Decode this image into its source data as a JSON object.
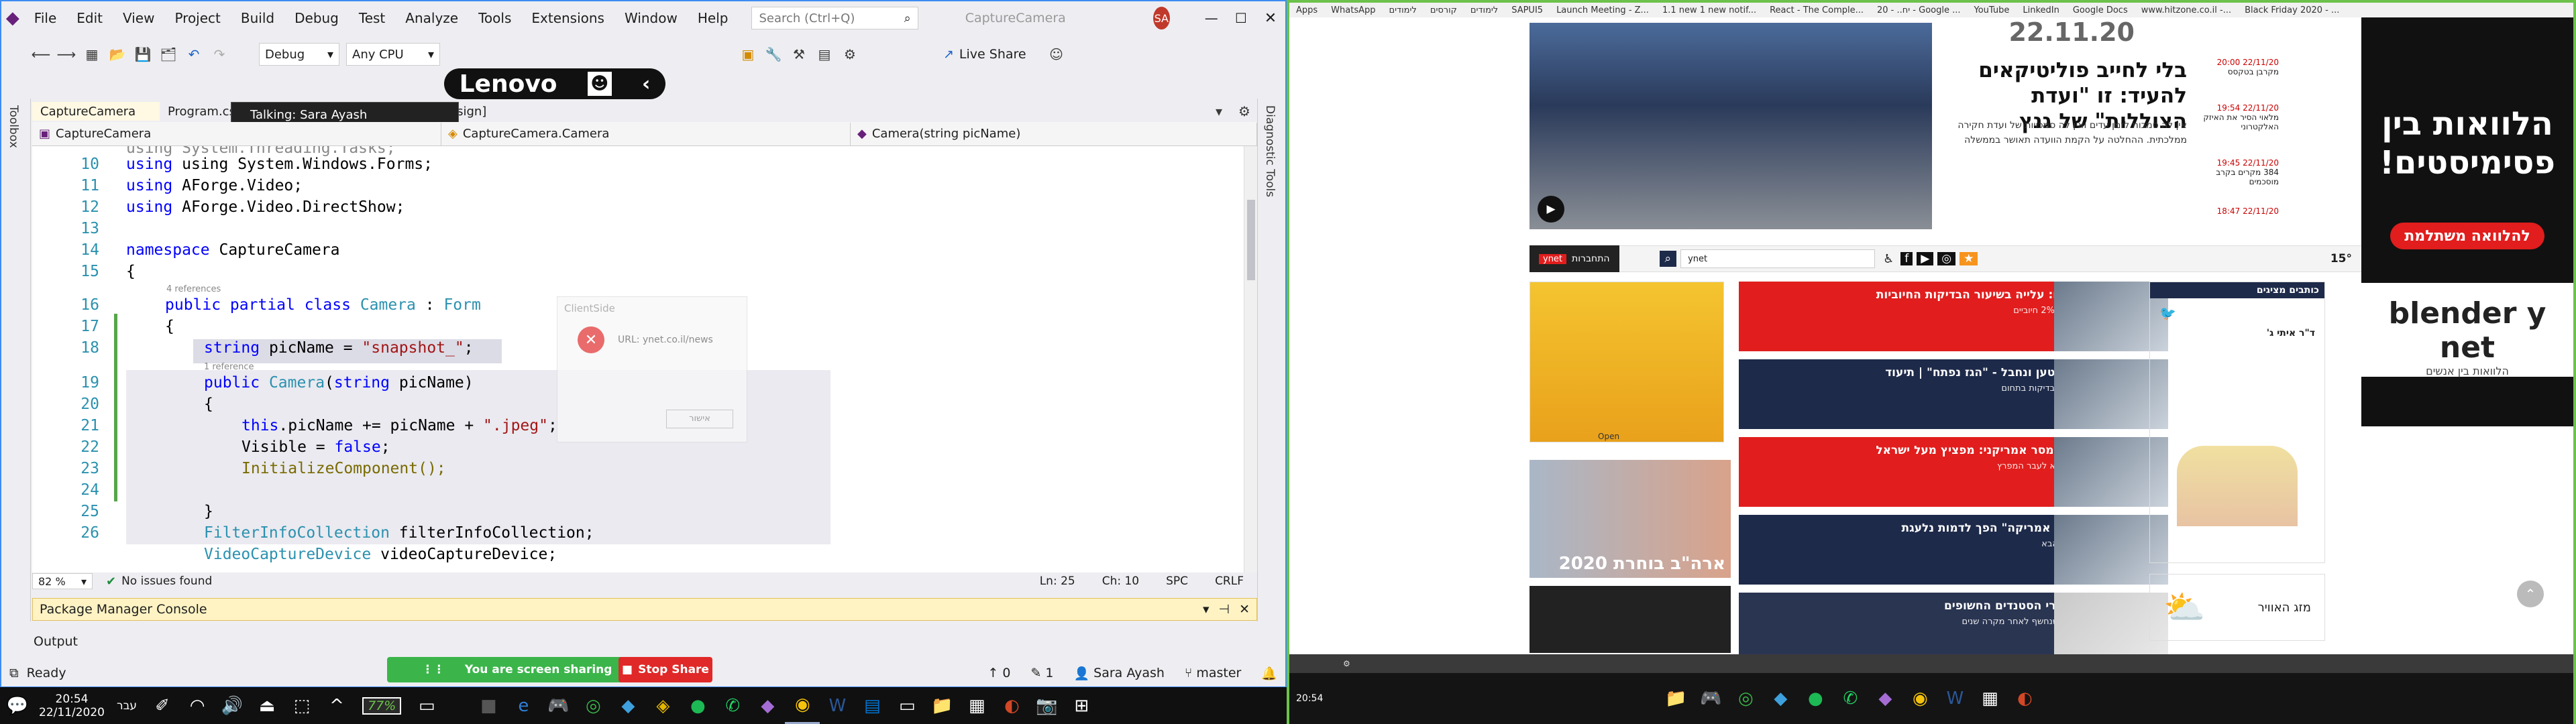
{
  "vs": {
    "menu": [
      "File",
      "Edit",
      "View",
      "Project",
      "Build",
      "Debug",
      "Test",
      "Analyze",
      "Tools",
      "Extensions",
      "Window",
      "Help"
    ],
    "search_placeholder": "Search (Ctrl+Q)",
    "solution_name": "CaptureCamera",
    "user_initials": "SA",
    "live_share": "Live Share",
    "config": "Debug",
    "platform": "Any CPU",
    "lenovo": "Lenovo",
    "talking": "Talking: Sara Ayash",
    "left_strip": "Toolbox",
    "right_strip": "Diagnostic Tools",
    "tabs": [
      "CaptureCamera",
      "Program.cs",
      "esign]"
    ],
    "nav": {
      "project": "CaptureCamera",
      "class": "CaptureCamera.Camera",
      "member": "Camera(string picName)"
    },
    "code": {
      "line10": "using System.Windows.Forms;",
      "line09": "using System.Threading.Tasks;",
      "line11_kw": "using",
      "line11_rest": " AForge.Video;",
      "line12_kw": "using",
      "line12_rest": " AForge.Video.DirectShow;",
      "line14_kw": "namespace",
      "line14_rest": " CaptureCamera",
      "line15": "{",
      "refs": "4 references",
      "line16_a": "public partial class",
      "line16_b": "Camera",
      "line16_c": " : ",
      "line16_d": "Form",
      "line17": "{",
      "line18_a": "string",
      "line18_b": " picName = ",
      "line18_c": "\"snapshot_\"",
      "line18_d": ";",
      "refs2": "1 reference",
      "line19_a": "public",
      "line19_b": "Camera",
      "line19_c": "(",
      "line19_d": "string",
      "line19_e": " picName)",
      "line20": "{",
      "line21_a": "this",
      "line21_b": ".picName += picName + ",
      "line21_c": "\".jpeg\"",
      "line21_d": ";",
      "line22_a": "Visible = ",
      "line22_b": "false",
      "line22_c": ";",
      "line23": "InitializeComponent();",
      "line25": "}",
      "line26_a": "FilterInfoCollection",
      "line26_b": " filterInfoCollection;",
      "line27_a": "VideoCaptureDevice",
      "line27_b": " videoCaptureDevice;"
    },
    "line_numbers": [
      "10",
      "11",
      "12",
      "13",
      "14",
      "15",
      "16",
      "17",
      "18",
      "19",
      "20",
      "21",
      "22",
      "23",
      "24",
      "25",
      "26"
    ],
    "zoom": "82 %",
    "issues": "No issues found",
    "pos": {
      "ln": "Ln: 25",
      "ch": "Ch: 10",
      "spc": "SPC",
      "crlf": "CRLF"
    },
    "client_side": {
      "title": "ClientSide",
      "url": "URL: ynet.co.il/news",
      "btn": "אישור"
    },
    "pmc": "Package Manager Console",
    "output": "Output",
    "status": {
      "ready": "Ready",
      "up": "0",
      "pencil": "1",
      "user": "Sara Ayash",
      "branch": "master",
      "bell": "1"
    },
    "sharing": "You are screen sharing",
    "stop_share": "Stop Share",
    "clock": {
      "time": "20:54",
      "date": "22/11/2020"
    },
    "lang": "עבר",
    "battery": "77%"
  },
  "browser": {
    "bookmarks": [
      "Apps",
      "WhatsApp",
      "לימודים",
      "קורסים",
      "לימודים",
      "SAPUI5",
      "Launch Meeting - Z...",
      "1.1 new 1 new notif...",
      "React - The Comple...",
      "20 - ..יח - Google ...",
      "YouTube",
      "LinkedIn",
      "Google Docs",
      "www.hitzone.co.il -...",
      "Black Friday 2020 - ..."
    ],
    "date_big": "22.11.20",
    "lead_title": "בלי לחייב פוליטיקאים להעיד: זו \"ועדת הצוללות\" של גנץ",
    "lead_sub": "אין לה סמכות לזמן עדים ואין לה סמכויות של ועדת חקירה ממלכתית. ההחלטה על הקמת הוועדה תאושר בממשלה",
    "news_ticker": [
      {
        "time": "22/11/20 20:00",
        "text": "מקרבן בטקסס"
      },
      {
        "time": "22/11/20 19:54",
        "text": "מלאוי הסיר את האיזק האלקטרוני"
      },
      {
        "time": "22/11/20 19:45",
        "text": "384 מקרים בקרב מוסכמים"
      },
      {
        "time": "22/11/20 18:47",
        "text": ""
      }
    ],
    "ad_title": "הלוואות בין פסימיסטים!",
    "ad_btn": "להלוואה משתלמת",
    "ad_brand": "blender y net",
    "ad_tag": "הלוואות בין אנשים",
    "nav_search": "ynet",
    "nav_temp": "15°",
    "nav_login": "התחברות",
    "stories": [
      {
        "title": "נתונים מדאיגים: עלייה בשיעור הבדיקות החיוביות",
        "sub": "לאחר השבוע יותר מ-2% חיוביים",
        "color": "red"
      },
      {
        "title": "טנק עלה על מטען ונחבל - \"הגז נפתח\" | תיעוד",
        "sub": "בעזה הותקף מטען - בדיקות בתחום",
        "color": "navy"
      },
      {
        "title": "איום איראני - ומסר אמריקני: מפציץ מעל ישראל",
        "sub": "מפציץ אמריקני ממריא לעבר המפרץ",
        "color": "red"
      },
      {
        "title": "\"ראש העיר של אמריקה\" הפך לדמות נלעגת",
        "sub": "רודי ג'וליאני - הדבר הבא",
        "color": "navy"
      },
      {
        "title": "הסודות של אתרי הסטנדים החשופים",
        "sub": "הסוף של המשתמש שנחשף לאחר מקרה שנים",
        "color": "light"
      }
    ],
    "election_label": "ארה\"ב בוחרת 2020",
    "columnists": "כותבים מציגים",
    "author_name": "ד\"ר איתי ג'",
    "weather_label": "מזג האוויר",
    "open": "Open",
    "bottom_clock": "20:54"
  }
}
